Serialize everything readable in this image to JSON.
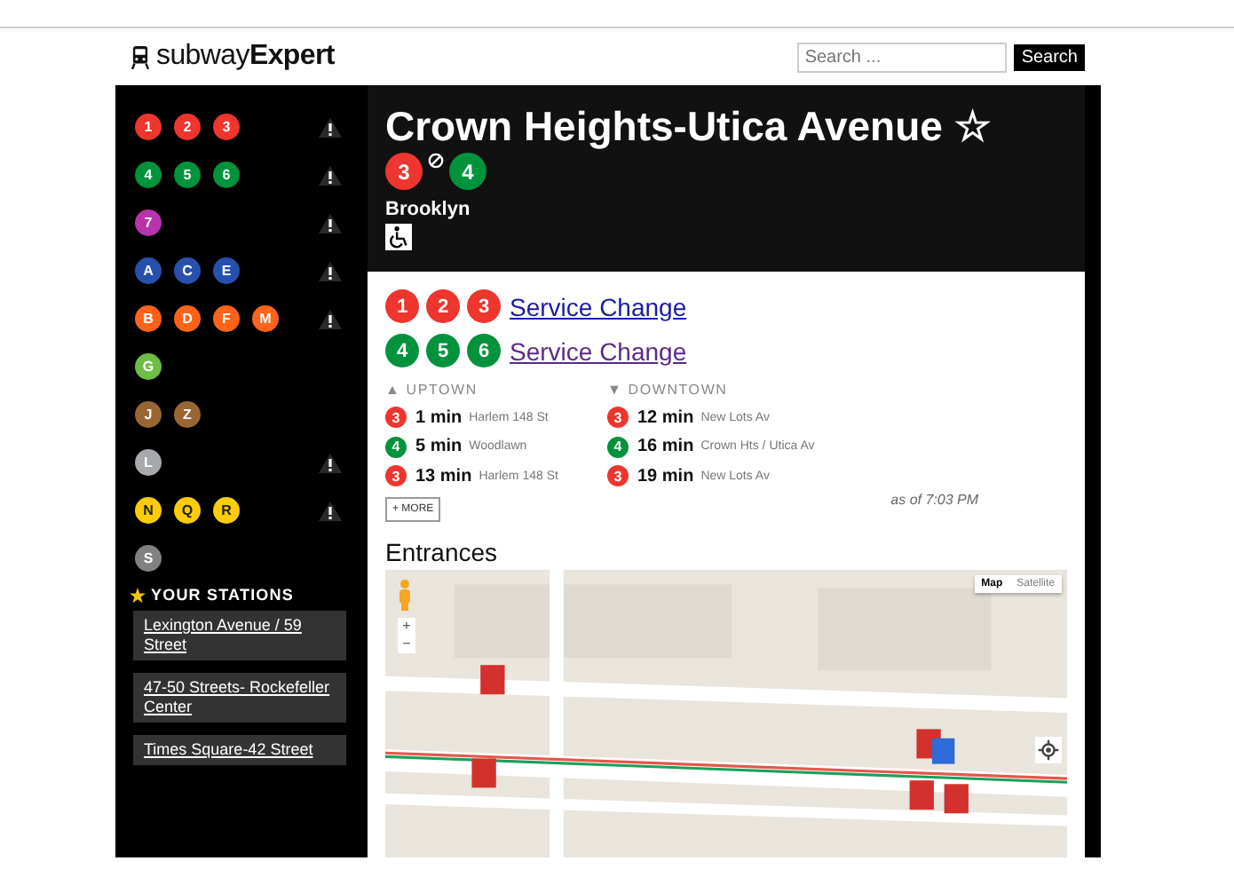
{
  "header": {
    "logo": {
      "plain": "subway",
      "bold": "Expert"
    },
    "search": {
      "placeholder": "Search ...",
      "button": "Search"
    }
  },
  "sidebar": {
    "line_groups": [
      {
        "lines": [
          {
            "label": "1",
            "color": "#ee352e"
          },
          {
            "label": "2",
            "color": "#ee352e"
          },
          {
            "label": "3",
            "color": "#ee352e"
          }
        ],
        "alert": true
      },
      {
        "lines": [
          {
            "label": "4",
            "color": "#00933c"
          },
          {
            "label": "5",
            "color": "#00933c"
          },
          {
            "label": "6",
            "color": "#00933c"
          }
        ],
        "alert": true
      },
      {
        "lines": [
          {
            "label": "7",
            "color": "#b933ad"
          }
        ],
        "alert": true
      },
      {
        "lines": [
          {
            "label": "A",
            "color": "#2850ad"
          },
          {
            "label": "C",
            "color": "#2850ad"
          },
          {
            "label": "E",
            "color": "#2850ad"
          }
        ],
        "alert": true
      },
      {
        "lines": [
          {
            "label": "B",
            "color": "#ff6319"
          },
          {
            "label": "D",
            "color": "#ff6319"
          },
          {
            "label": "F",
            "color": "#ff6319"
          },
          {
            "label": "M",
            "color": "#ff6319"
          }
        ],
        "alert": true
      },
      {
        "lines": [
          {
            "label": "G",
            "color": "#6cbe45"
          }
        ],
        "alert": false
      },
      {
        "lines": [
          {
            "label": "J",
            "color": "#996633"
          },
          {
            "label": "Z",
            "color": "#996633"
          }
        ],
        "alert": false
      },
      {
        "lines": [
          {
            "label": "L",
            "color": "#a7a9ac"
          }
        ],
        "alert": true
      },
      {
        "lines": [
          {
            "label": "N",
            "color": "#fccc0a"
          },
          {
            "label": "Q",
            "color": "#fccc0a"
          },
          {
            "label": "R",
            "color": "#fccc0a"
          }
        ],
        "alert": true
      },
      {
        "lines": [
          {
            "label": "S",
            "color": "#808183"
          }
        ],
        "alert": false
      }
    ],
    "your_stations": {
      "heading": "YOUR STATIONS",
      "items": [
        "Lexington Avenue / 59 Street",
        "47-50 Streets- Rockefeller Center",
        "Times Square-42 Street"
      ]
    }
  },
  "station": {
    "name": "Crown Heights-Utica Avenue",
    "star": "☆",
    "lines": [
      {
        "label": "3",
        "color": "#ee352e"
      },
      {
        "label": "4",
        "color": "#00933c"
      }
    ],
    "borough": "Brooklyn",
    "accessible": true
  },
  "service_changes": [
    {
      "lines": [
        {
          "label": "1",
          "color": "#ee352e"
        },
        {
          "label": "2",
          "color": "#ee352e"
        },
        {
          "label": "3",
          "color": "#ee352e"
        }
      ],
      "link": "Service Change",
      "visited": false
    },
    {
      "lines": [
        {
          "label": "4",
          "color": "#00933c"
        },
        {
          "label": "5",
          "color": "#00933c"
        },
        {
          "label": "6",
          "color": "#00933c"
        }
      ],
      "link": "Service Change",
      "visited": true
    }
  ],
  "arrivals": {
    "columns": [
      {
        "arrow": "▲",
        "direction": "UPTOWN",
        "trains": [
          {
            "line": {
              "label": "3",
              "color": "#ee352e"
            },
            "time": "1 min",
            "destination": "Harlem 148 St"
          },
          {
            "line": {
              "label": "4",
              "color": "#00933c"
            },
            "time": "5 min",
            "destination": "Woodlawn"
          },
          {
            "line": {
              "label": "3",
              "color": "#ee352e"
            },
            "time": "13 min",
            "destination": "Harlem 148 St"
          }
        ]
      },
      {
        "arrow": "▼",
        "direction": "DOWNTOWN",
        "trains": [
          {
            "line": {
              "label": "3",
              "color": "#ee352e"
            },
            "time": "12 min",
            "destination": "New Lots Av"
          },
          {
            "line": {
              "label": "4",
              "color": "#00933c"
            },
            "time": "16 min",
            "destination": "Crown Hts / Utica Av"
          },
          {
            "line": {
              "label": "3",
              "color": "#ee352e"
            },
            "time": "19 min",
            "destination": "New Lots Av"
          }
        ]
      }
    ],
    "more_button": "+ MORE",
    "updated": "as of 7:03 PM"
  },
  "entrances": {
    "heading": "Entrances",
    "map": {
      "kind": "picture",
      "map_types": [
        {
          "label": "Map",
          "selected": true
        },
        {
          "label": "Satellite",
          "selected": false
        }
      ],
      "zoom": [
        "+",
        "−"
      ]
    }
  }
}
